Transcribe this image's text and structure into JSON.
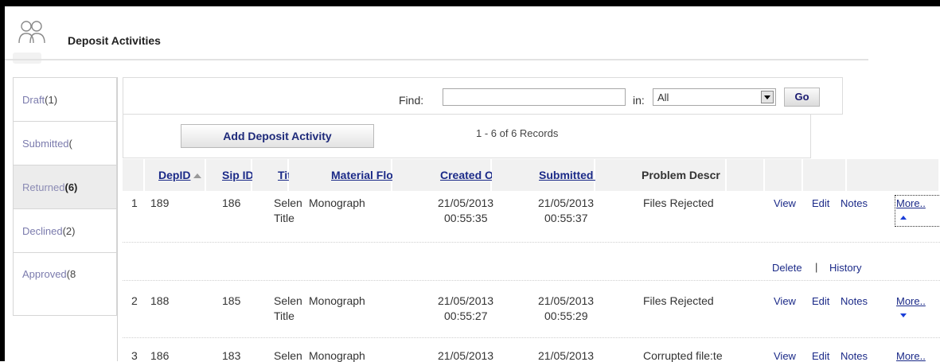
{
  "header": {
    "title": "Deposit Activities",
    "icon": "users-icon"
  },
  "tabs": [
    {
      "label": "Draft",
      "count": "(1)",
      "active": false
    },
    {
      "label": "Submitted",
      "count": "(",
      "active": false
    },
    {
      "label": "Returned",
      "count": "(6)",
      "active": true
    },
    {
      "label": "Declined",
      "count": "(2)",
      "active": false
    },
    {
      "label": "Approved",
      "count": "(8",
      "active": false
    }
  ],
  "find": {
    "label": "Find:",
    "value": "",
    "in_label": "in:",
    "in_value": "All",
    "go_label": "Go"
  },
  "toolbar": {
    "add_label": "Add Deposit Activity",
    "records": "1 - 6 of 6 Records"
  },
  "columns": [
    "DepID",
    "Sip ID",
    "Title",
    "Material Flow",
    "Created On",
    "Submitted On",
    "Problem Descr"
  ],
  "rows": [
    {
      "num": "1",
      "depid": "189",
      "sipid": "186",
      "title1": "Selen",
      "title2": "Title",
      "flow": "Monograph",
      "created_date": "21/05/2013",
      "created_time": "00:55:35",
      "submitted_date": "21/05/2013",
      "submitted_time": "00:55:37",
      "problem": "Files Rejected",
      "actions": [
        "View",
        "Edit",
        "Notes",
        "More.."
      ],
      "expanded": true
    },
    {
      "num": "2",
      "depid": "188",
      "sipid": "185",
      "title1": "Selen",
      "title2": "Title",
      "flow": "Monograph",
      "created_date": "21/05/2013",
      "created_time": "00:55:27",
      "submitted_date": "21/05/2013",
      "submitted_time": "00:55:29",
      "problem": "Files Rejected",
      "actions": [
        "View",
        "Edit",
        "Notes",
        "More.."
      ],
      "expanded": false
    },
    {
      "num": "3",
      "depid": "186",
      "sipid": "183",
      "title1": "Selen",
      "title2": "",
      "flow": "Monograph",
      "created_date": "21/05/2013",
      "created_time": "",
      "submitted_date": "21/05/2013",
      "submitted_time": "",
      "problem": "Corrupted file:te",
      "actions": [
        "View",
        "Edit",
        "Notes",
        "More.."
      ],
      "expanded": false
    }
  ],
  "expanded_actions": {
    "delete": "Delete",
    "separator": "|",
    "history": "History"
  }
}
